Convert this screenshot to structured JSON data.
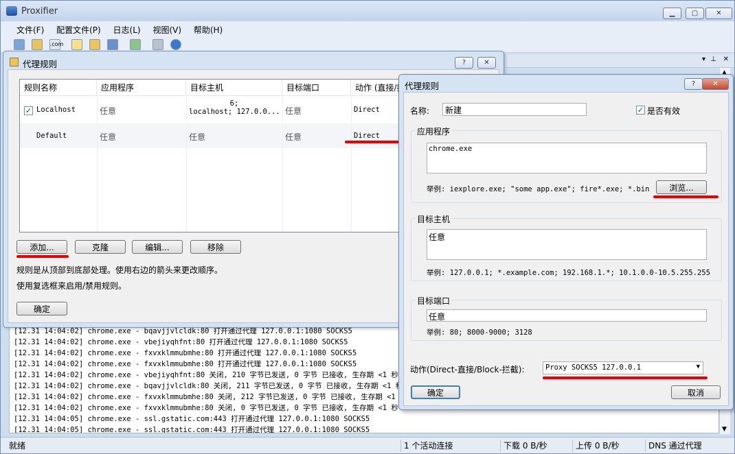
{
  "app": {
    "title": "Proxifier",
    "menu": [
      "文件(F)",
      "配置文件(P)",
      "日志(L)",
      "视图(V)",
      "帮助(H)"
    ]
  },
  "log_lines": [
    "[12.31 14:04:02] chrome.exe - bqavjjvlcldk:80 打开通过代理 127.0.0.1:1080 SOCKS5",
    "[12.31 14:04:02] chrome.exe - vbejiyqhfnt:80 打开通过代理 127.0.0.1:1080 SOCKS5",
    "[12.31 14:04:02] chrome.exe - fxvxklmmubmhe:80 打开通过代理 127.0.0.1:1080 SOCKS5",
    "[12.31 14:04:02] chrome.exe - fxvxklmmubmhe:80 打开通过代理 127.0.0.1:1080 SOCKS5",
    "[12.31 14:04:02] chrome.exe - vbejiyqhfnt:80 关闭, 210 字节已发送, 0 字节 已接收, 生存期 <1 秒",
    "[12.31 14:04:02] chrome.exe - bqavjjvlcldk:80 关闭, 211 字节已发送, 0 字节 已接收, 生存期 <1 秒",
    "[12.31 14:04:02] chrome.exe - fxvxklmmubmhe:80 关闭, 212 字节已发送, 0 字节 已接收, 生存期 <1 秒",
    "[12.31 14:04:02] chrome.exe - fxvxklmmubmhe:80 关闭, 0 字节已发送, 0 字节 已接收, 生存期 <1 秒",
    "[12.31 14:04:05] chrome.exe - ssl.gstatic.com:443 打开通过代理 127.0.0.1:1080 SOCKS5",
    "[12.31 14:04:05] chrome.exe - ssl.gstatic.com:443 打开通过代理 127.0.0.1:1080 SOCKS5"
  ],
  "status": {
    "ready": "就绪",
    "connections": "1 个活动连接",
    "download": "下载 0 B/秒",
    "upload": "上传 0 B/秒",
    "dns": "DNS 通过代理"
  },
  "rules_dialog": {
    "title": "代理规则",
    "help": "?",
    "close": "✕",
    "columns": [
      "规则名称",
      "应用程序",
      "目标主机",
      "目标端口",
      "动作 (直接/拦"
    ],
    "rows": [
      {
        "checked": true,
        "name": "Localhost",
        "app": "任意",
        "host": "6;\nlocalhost; 127.0.0...",
        "port": "任意",
        "action": "Direct"
      },
      {
        "checked": false,
        "name": "Default",
        "app": "任意",
        "host": "任意",
        "port": "任意",
        "action": "Direct"
      }
    ],
    "buttons": {
      "add": "添加...",
      "clone": "克隆",
      "edit": "编辑...",
      "remove": "移除",
      "ok": "确定"
    },
    "hint1": "规则是从顶部到底部处理。使用右边的箭头来更改顺序。",
    "hint2": "使用复选框来启用/禁用规则。"
  },
  "rule_edit": {
    "title": "代理规则",
    "help": "?",
    "close": "✕",
    "name_label": "名称:",
    "name_value": "新建",
    "enabled_label": "是否有效",
    "enabled": true,
    "app_group": "应用程序",
    "app_value": "chrome.exe",
    "app_example": "举例: iexplore.exe; \"some app.exe\"; fire*.exe; *.bin",
    "browse": "浏览...",
    "host_group": "目标主机",
    "host_value": "任意",
    "host_example": "举例: 127.0.0.1; *.example.com; 192.168.1.*; 10.1.0.0-10.5.255.255",
    "port_group": "目标端口",
    "port_value": "任意",
    "port_example": "举例: 80; 8000-9000; 3128",
    "action_label": "动作(Direct-直接/Block-拦截):",
    "action_value": "Proxy SOCKS5 127.0.0.1",
    "ok": "确定",
    "cancel": "取消"
  },
  "colors": {
    "accent_underline": "#e00000",
    "title_bg": "#c8d9ee"
  }
}
